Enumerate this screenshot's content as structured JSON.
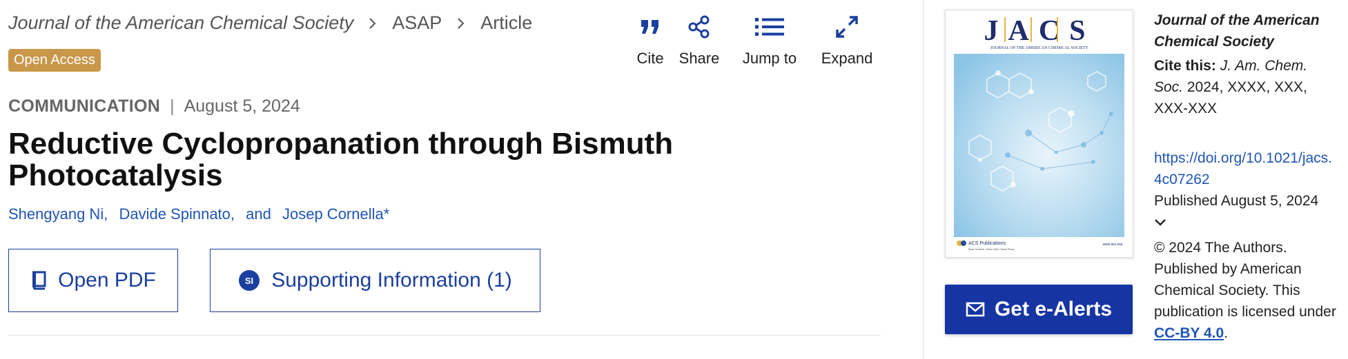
{
  "breadcrumb": {
    "journal": "Journal of the American Chemical Society",
    "section": "ASAP",
    "page": "Article"
  },
  "badge": {
    "label": "Open Access"
  },
  "tools": {
    "cite": "Cite",
    "share": "Share",
    "jump_to": "Jump to",
    "expand": "Expand"
  },
  "article": {
    "type": "COMMUNICATION",
    "separator": "|",
    "date": "August 5, 2024",
    "title": "Reductive Cyclopropanation through Bismuth Photocatalysis",
    "authors": [
      "Shengyang Ni,",
      "Davide Spinnato,",
      "and",
      "Josep Cornella*"
    ]
  },
  "actions": {
    "open_pdf": "Open PDF",
    "si_badge": "SI",
    "supporting_info": "Supporting Information (1)"
  },
  "cover": {
    "masthead": "JACS",
    "masthead_sub": "JOURNAL OF THE AMERICAN CHEMICAL SOCIETY",
    "publisher": "ACS Publications",
    "publisher_sub": "Most Trusted. Most Cited. Most Read.",
    "url": "www.acs.org"
  },
  "alerts": {
    "label": "Get e-Alerts"
  },
  "sidebar": {
    "journal": "Journal of the American Chemical Society",
    "cite_label": "Cite this:",
    "cite_journal": "J. Am. Chem. Soc.",
    "cite_rest": "2024, XXXX, XXX, XXX-XXX",
    "doi": "https://doi.org/10.1021/jacs.4c07262",
    "published": "Published August 5, 2024",
    "copyright": "© 2024 The Authors. Published by American Chemical Society. This publication is licensed under",
    "license": "CC-BY 4.0",
    "period": "."
  },
  "colors": {
    "accent": "#1a3f9e",
    "link": "#1f55b5",
    "badge": "#c9974a",
    "alerts_button": "#1635a3"
  },
  "icons": {
    "cite": "quote-icon",
    "share": "share-icon",
    "jump_to": "list-icon",
    "expand": "expand-icon",
    "pdf": "book-icon",
    "alerts": "envelope-icon",
    "published_toggle": "chevron-down-icon"
  }
}
